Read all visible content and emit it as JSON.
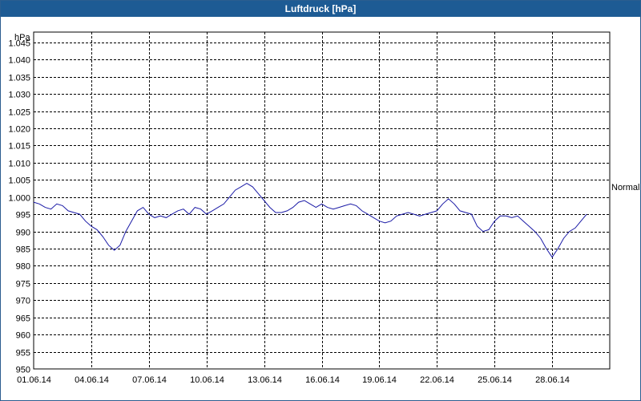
{
  "window": {
    "title": "Luftdruck [hPa]"
  },
  "chart_data": {
    "type": "line",
    "title": "Luftdruck [hPa]",
    "ylabel": "hPa",
    "ylim": [
      950,
      1048
    ],
    "xlim": [
      "2014-06-01",
      "2014-07-01"
    ],
    "grid": true,
    "y_ticks": [
      "950",
      "955",
      "960",
      "965",
      "970",
      "975",
      "980",
      "985",
      "990",
      "995",
      "1.000",
      "1.005",
      "1.010",
      "1.015",
      "1.020",
      "1.025",
      "1.030",
      "1.035",
      "1.040",
      "1.045"
    ],
    "y_tick_values": [
      950,
      955,
      960,
      965,
      970,
      975,
      980,
      985,
      990,
      995,
      1000,
      1005,
      1010,
      1015,
      1020,
      1025,
      1030,
      1035,
      1040,
      1045
    ],
    "x_ticks": [
      "01.06.14",
      "04.06.14",
      "07.06.14",
      "10.06.14",
      "13.06.14",
      "16.06.14",
      "19.06.14",
      "22.06.14",
      "25.06.14",
      "28.06.14"
    ],
    "x_tick_days": [
      0,
      3,
      6,
      9,
      12,
      15,
      18,
      21,
      24,
      27
    ],
    "reference_line": {
      "label": "Normal"
    },
    "colors": {
      "series": "#1a1aa6",
      "grid": "#000000"
    },
    "series": [
      {
        "x_days": [
          0,
          0.3,
          0.6,
          0.9,
          1.2,
          1.5,
          1.8,
          2.1,
          2.4,
          2.7,
          3.0,
          3.3,
          3.6,
          3.9,
          4.2,
          4.5,
          4.8,
          5.1,
          5.4,
          5.7,
          6.0,
          6.3,
          6.6,
          6.9,
          7.2,
          7.5,
          7.8,
          8.1,
          8.4,
          8.7,
          9.0,
          9.3,
          9.6,
          9.9,
          10.2,
          10.5,
          10.8,
          11.1,
          11.4,
          11.7,
          12.0,
          12.3,
          12.6,
          12.9,
          13.2,
          13.5,
          13.8,
          14.1,
          14.4,
          14.7,
          15.0,
          15.3,
          15.6,
          15.9,
          16.2,
          16.5,
          16.8,
          17.1,
          17.4,
          17.7,
          18.0,
          18.3,
          18.6,
          18.9,
          19.2,
          19.5,
          19.8,
          20.1,
          20.4,
          20.7,
          21.0,
          21.3,
          21.6,
          21.9,
          22.2,
          22.5,
          22.8,
          23.1,
          23.4,
          23.7,
          24.0,
          24.3,
          24.6,
          24.9,
          25.2,
          25.5,
          25.8,
          26.1,
          26.4,
          26.7,
          27.0,
          27.3,
          27.6,
          27.9,
          28.2,
          28.5,
          28.8,
          29.1,
          29.4,
          29.7
        ],
        "values": [
          998.5,
          998,
          997,
          996.5,
          998,
          997.5,
          996,
          995.5,
          995,
          993,
          991.5,
          990.5,
          988.5,
          986,
          984.5,
          986,
          990,
          993,
          996,
          997,
          995,
          994,
          994.5,
          994,
          995,
          996,
          996.5,
          995,
          997,
          996.5,
          995,
          996,
          997,
          998,
          1000,
          1002,
          1003,
          1004,
          1003,
          1001,
          999,
          997,
          995.5,
          995.5,
          996,
          997,
          998.5,
          999,
          998,
          997,
          998,
          997,
          996.5,
          997,
          997.5,
          998,
          997.5,
          996,
          995,
          994,
          993,
          992.5,
          993,
          994.5,
          995,
          995.5,
          995,
          994.5,
          995,
          995.5,
          996,
          998,
          999.5,
          998,
          996,
          995.5,
          995,
          991.5,
          990,
          990.5,
          993,
          994.5,
          994.5,
          994,
          994.5,
          993,
          991.5,
          990,
          988,
          985,
          982.5,
          985,
          988,
          990,
          991,
          993,
          995
        ]
      }
    ]
  }
}
